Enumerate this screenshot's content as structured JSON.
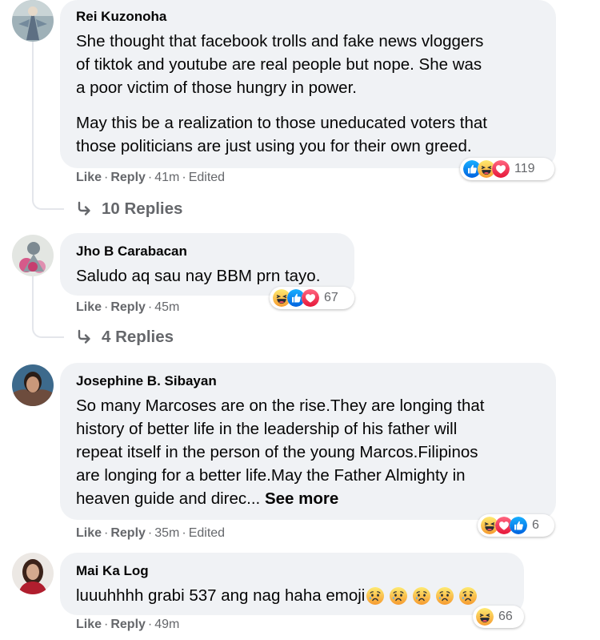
{
  "comments": [
    {
      "author": "Rei Kuzonoha",
      "paragraphs": [
        [
          "She thought that facebook trolls and fake news vloggers",
          "of tiktok and youtube are real people but nope. She was",
          "a poor victim of those hungry in power."
        ],
        [
          "May this be a realization to those uneducated voters that",
          "those politicians are just using you for their own greed."
        ]
      ],
      "like_label": "Like",
      "reply_label": "Reply",
      "time": "41m",
      "edited_label": "Edited",
      "reactions": [
        "like",
        "haha",
        "love"
      ],
      "reaction_count": "119",
      "replies_label": "10 Replies"
    },
    {
      "author": "Jho B Carabacan",
      "paragraphs": [
        [
          "Saludo aq sau nay BBM prn tayo."
        ]
      ],
      "like_label": "Like",
      "reply_label": "Reply",
      "time": "45m",
      "reactions": [
        "haha",
        "like",
        "love"
      ],
      "reaction_count": "67",
      "replies_label": "4 Replies"
    },
    {
      "author": "Josephine B. Sibayan",
      "paragraphs": [
        [
          "So many Marcoses are on the rise.They are longing that",
          "history of better life in the leadership of his father will",
          "repeat itself in the person of the young Marcos.Filipinos",
          "are longing for a better life.May the Father Almighty in",
          "heaven guide and direc..."
        ]
      ],
      "see_more_label": "See more",
      "like_label": "Like",
      "reply_label": "Reply",
      "time": "35m",
      "edited_label": "Edited",
      "reactions": [
        "haha",
        "love",
        "like"
      ],
      "reaction_count": "6"
    },
    {
      "author": "Mai Ka Log",
      "paragraphs": [
        [
          "luuuhhhh grabi 537 ang nag haha emoji"
        ]
      ],
      "inline_emojis": [
        "sad-crying",
        "sad-crying",
        "sad-crying",
        "sad-crying",
        "sad-crying"
      ],
      "like_label": "Like",
      "reply_label": "Reply",
      "time": "49m",
      "reactions": [
        "haha"
      ],
      "reaction_count": "66"
    }
  ],
  "colors": {
    "bubble": "#f0f2f5",
    "meta_text": "#65676b",
    "like_blue": "#1877f2",
    "love_red": "#f33e58",
    "haha_yellow": "#f7b928"
  }
}
